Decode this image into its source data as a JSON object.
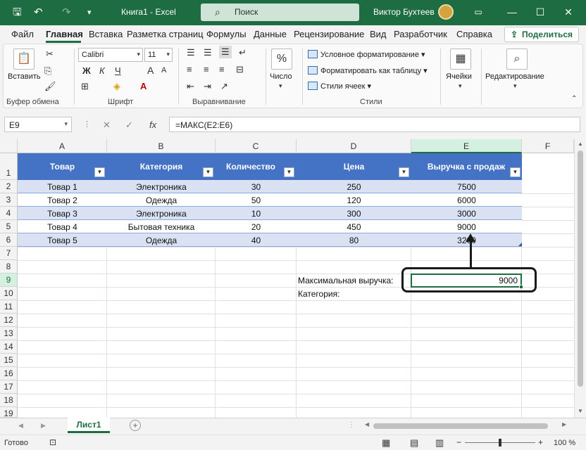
{
  "window": {
    "title": "Книга1 - Excel",
    "search_placeholder": "Поиск",
    "user_name": "Виктор Бухтеев",
    "minimize": "—",
    "maximize": "☐",
    "close": "✕"
  },
  "quick_access": {
    "save": "🖫",
    "undo": "↶",
    "redo": "↷",
    "customize": "▾"
  },
  "ribbon_tabs": [
    "Файл",
    "Главная",
    "Вставка",
    "Разметка страниц",
    "Формулы",
    "Данные",
    "Рецензирование",
    "Вид",
    "Разработчик",
    "Справка"
  ],
  "share_label": "Поделиться",
  "ribbon": {
    "clipboard": {
      "paste": "Вставить",
      "group": "Буфер обмена"
    },
    "font": {
      "name": "Calibri",
      "size": "11",
      "bold": "Ж",
      "italic": "К",
      "underline": "Ч",
      "grow": "A",
      "shrink": "A",
      "group": "Шрифт"
    },
    "alignment": {
      "group": "Выравнивание"
    },
    "number": {
      "label": "Число",
      "icon": "%"
    },
    "styles": {
      "conditional": "Условное форматирование",
      "as_table": "Форматировать как таблицу",
      "cell_styles": "Стили ячеек",
      "group": "Стили"
    },
    "cells": {
      "label": "Ячейки"
    },
    "editing": {
      "label": "Редактирование"
    }
  },
  "formula_bar": {
    "name_box": "E9",
    "formula": "=МАКС(E2:E6)",
    "cancel": "✕",
    "enter": "✓",
    "fx": "fx"
  },
  "columns": [
    "A",
    "B",
    "C",
    "D",
    "E",
    "F"
  ],
  "rows": [
    "1",
    "2",
    "3",
    "4",
    "5",
    "6",
    "7",
    "8",
    "9",
    "10",
    "11",
    "12",
    "13",
    "14",
    "15",
    "16",
    "17",
    "18",
    "19"
  ],
  "table": {
    "headers": [
      "Товар",
      "Категория",
      "Количество",
      "Цена",
      "Выручка с продаж"
    ],
    "filter_icon": "▼",
    "rows": [
      [
        "Товар 1",
        "Электроника",
        "30",
        "250",
        "7500"
      ],
      [
        "Товар 2",
        "Одежда",
        "50",
        "120",
        "6000"
      ],
      [
        "Товар 3",
        "Электроника",
        "10",
        "300",
        "3000"
      ],
      [
        "Товар 4",
        "Бытовая техника",
        "20",
        "450",
        "9000"
      ],
      [
        "Товар 5",
        "Одежда",
        "40",
        "80",
        "3200"
      ]
    ]
  },
  "labels": {
    "max_revenue": "Максимальная выручка:",
    "category": "Категория:"
  },
  "result": {
    "value": "9000"
  },
  "sheet_tab": "Лист1",
  "status": {
    "ready": "Готово",
    "zoom": "100 %"
  },
  "colors": {
    "title_bar": "#1e6c41",
    "table_header": "#4472c4",
    "band": "#d9e1f2"
  }
}
